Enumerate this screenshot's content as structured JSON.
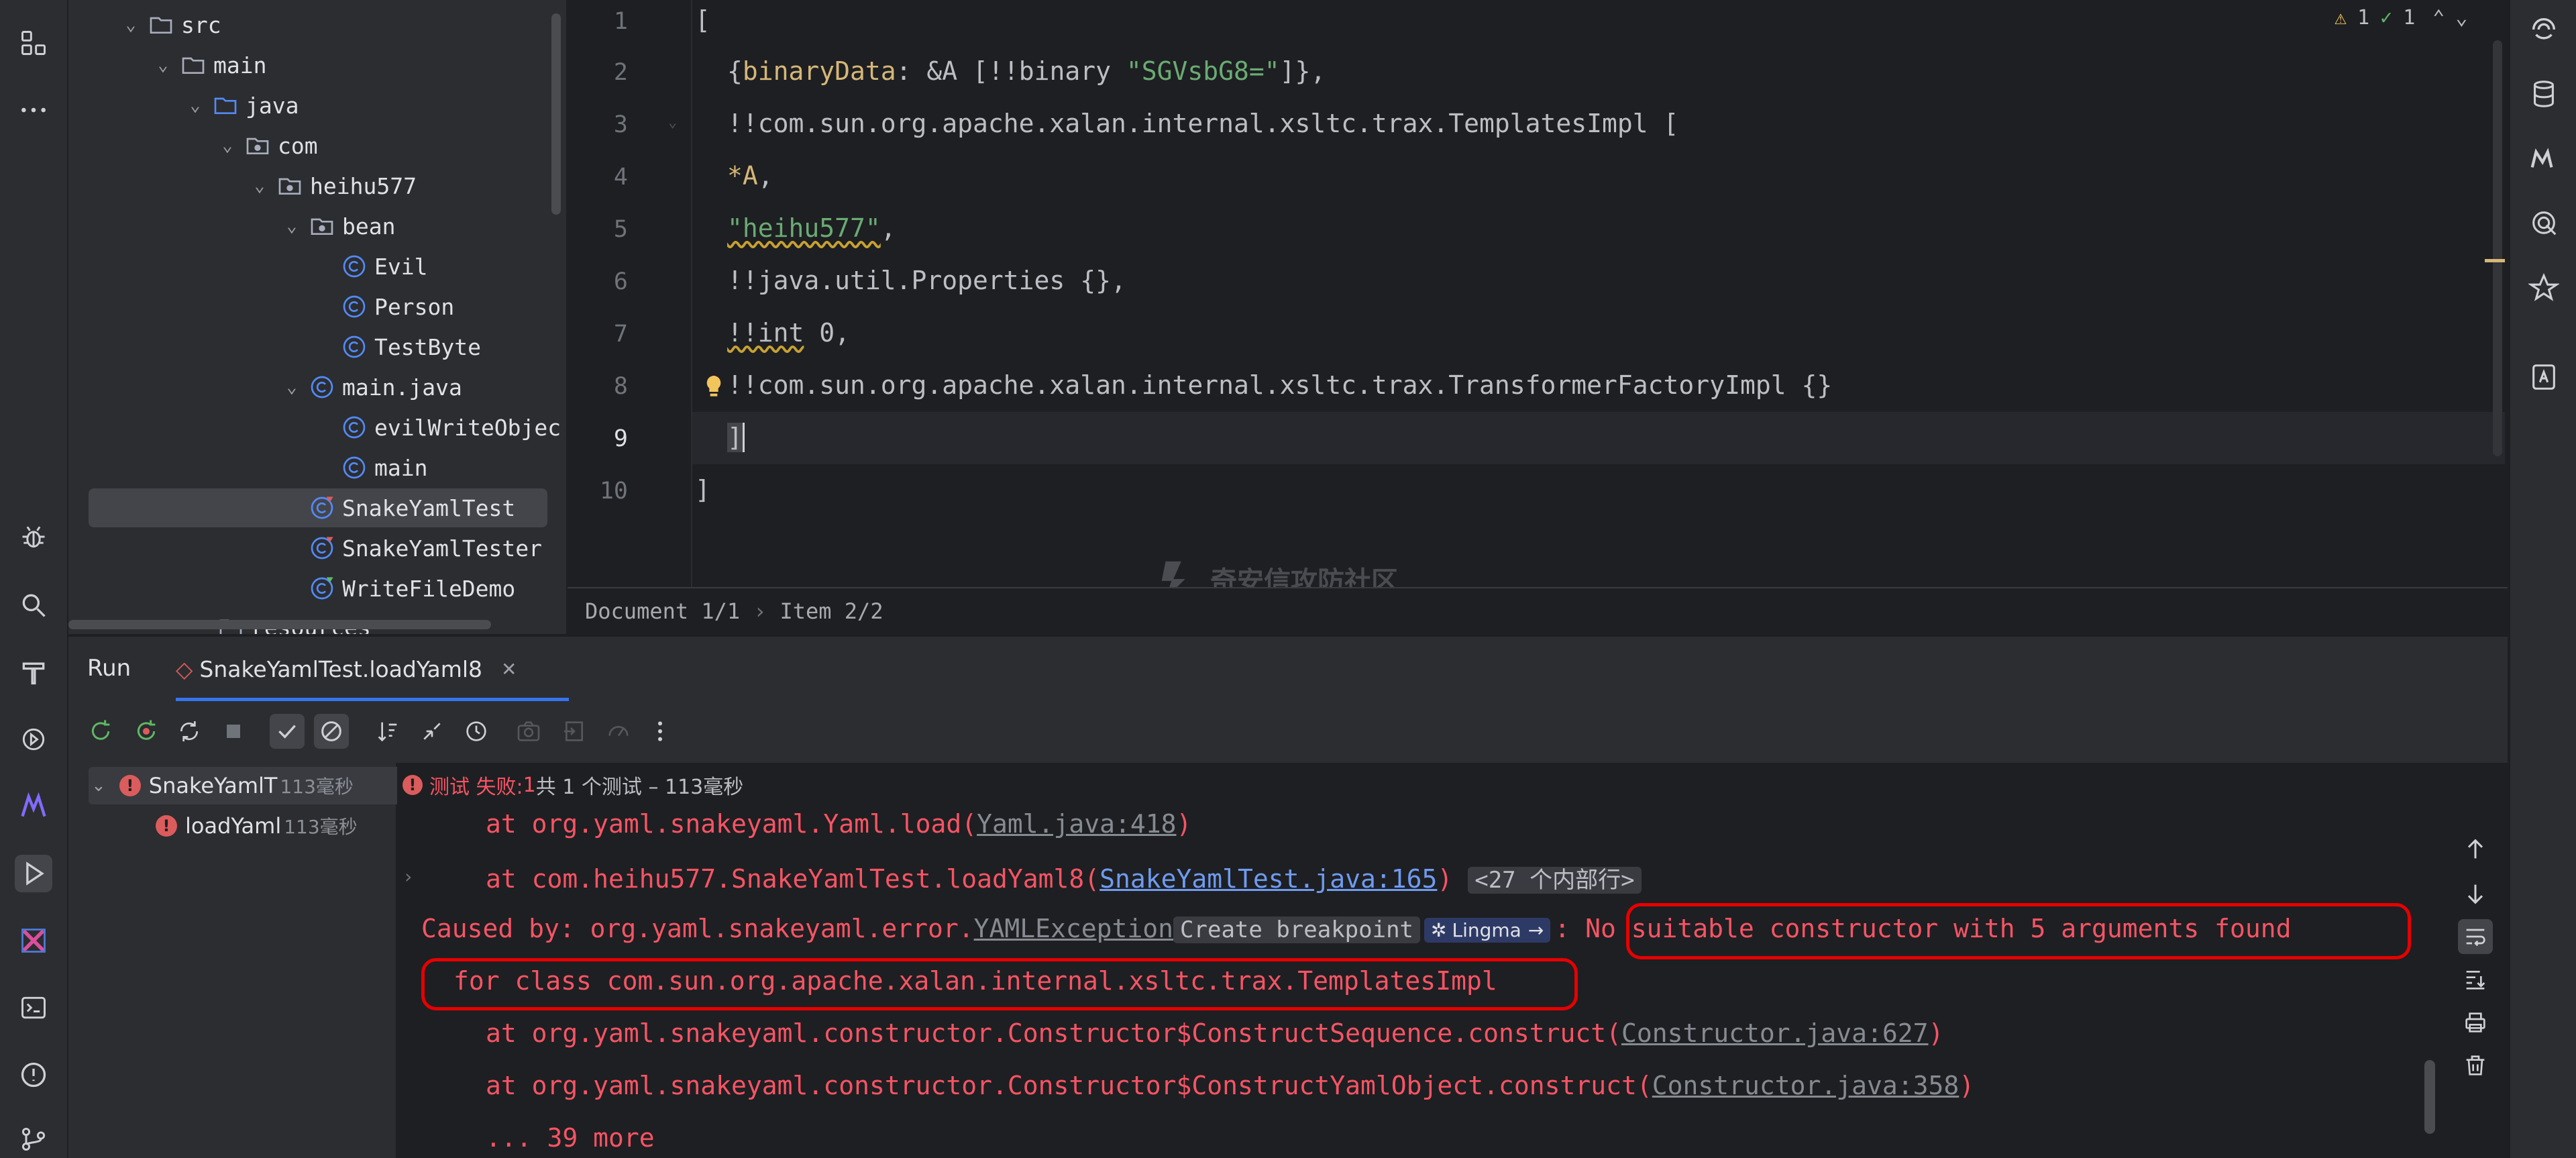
{
  "project_tree": {
    "items": [
      {
        "label": "src",
        "kind": "folder"
      },
      {
        "label": "main",
        "kind": "folder"
      },
      {
        "label": "java",
        "kind": "source-folder"
      },
      {
        "label": "com",
        "kind": "package"
      },
      {
        "label": "heihu577",
        "kind": "package"
      },
      {
        "label": "bean",
        "kind": "package"
      },
      {
        "label": "Evil",
        "kind": "class"
      },
      {
        "label": "Person",
        "kind": "class"
      },
      {
        "label": "TestByte",
        "kind": "class"
      },
      {
        "label": "main.java",
        "kind": "class"
      },
      {
        "label": "evilWriteObjec",
        "kind": "class"
      },
      {
        "label": "main",
        "kind": "class"
      },
      {
        "label": "SnakeYamlTest",
        "kind": "test-class",
        "selected": true
      },
      {
        "label": "SnakeYamlTester",
        "kind": "test-class"
      },
      {
        "label": "WriteFileDemo",
        "kind": "test-class"
      },
      {
        "label": "resources",
        "kind": "folder"
      }
    ]
  },
  "editor": {
    "line_numbers": [
      "1",
      "2",
      "3",
      "4",
      "5",
      "6",
      "7",
      "8",
      "9",
      "10"
    ],
    "lines": {
      "l1": "[",
      "l2_key": "binaryData",
      "l2_mid": ": &A [!!binary ",
      "l2_str": "\"SGVsbG8=\"",
      "l2_end": "]},",
      "l2_open": "{",
      "l3": "!!com.sun.org.apache.xalan.internal.xsltc.trax.TemplatesImpl [",
      "l4_star": "*A",
      "l4_end": ",",
      "l5_str": "\"heihu577\"",
      "l5_end": ",",
      "l6": "!!java.util.Properties {},",
      "l7_tag": "!!int",
      "l7_rest": " 0,",
      "l8": "!!com.sun.org.apache.xalan.internal.xsltc.trax.TransformerFactoryImpl {}",
      "l9": "]",
      "l10": "]"
    },
    "inspections": {
      "warnings": "1",
      "ok": "1"
    }
  },
  "breadcrumb": {
    "document": "Document 1/1",
    "item": "Item 2/2"
  },
  "watermark": "奇安信攻防社区",
  "run": {
    "title": "Run",
    "tab_label": "SnakeYamlTest.loadYaml8",
    "status": {
      "prefix": "测试 失败: ",
      "failed": "1",
      "rest": "共 1 个测试 – 113毫秒"
    },
    "tests": [
      {
        "label": "SnakeYamlT",
        "duration": "113毫秒"
      },
      {
        "label": "loadYaml",
        "duration": "113毫秒"
      }
    ],
    "console": {
      "line0_pre": "at org.yaml.snakeyaml.Yaml.load(",
      "line0_link": "Yaml.java:418",
      "line0_post": ")",
      "line1_pre": "at com.heihu577.SnakeYamlTest.loadYaml8(",
      "line1_link": "SnakeYamlTest.java:165",
      "line1_post": ")",
      "line1_inlay": "<27 个内部行>",
      "line2_pre": "Caused by: org.yaml.snakeyaml.error.",
      "line2_link": "YAMLException",
      "line2_inlay": "Create breakpoint",
      "line2_lingma": "Lingma",
      "line2_post": ": No suitable constructor with 5 arguments found",
      "line3": "for class com.sun.org.apache.xalan.internal.xsltc.trax.TemplatesImpl",
      "line4_pre": "at org.yaml.snakeyaml.constructor.Constructor$ConstructSequence.construct(",
      "line4_link": "Constructor.java:627",
      "line4_post": ")",
      "line5_pre": "at org.yaml.snakeyaml.constructor.Constructor$ConstructYamlObject.construct(",
      "line5_link": "Constructor.java:358",
      "line5_post": ")",
      "line6": "... 39 more"
    }
  },
  "colors": {
    "accent": "#3574f0",
    "error": "#f75464",
    "annotation_box": "#e60000",
    "string": "#6aab73",
    "key": "#d5b778"
  }
}
